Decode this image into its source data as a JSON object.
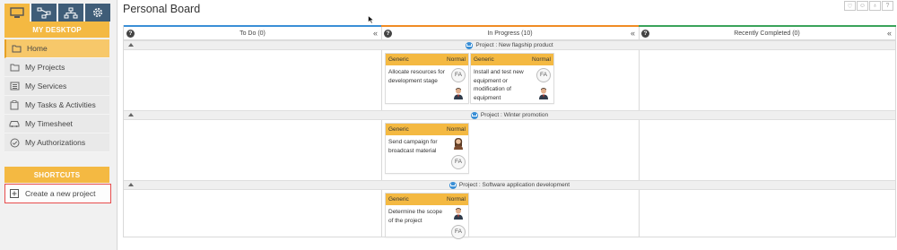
{
  "sidebar": {
    "section_title": "MY DESKTOP",
    "shortcuts_title": "SHORTCUTS",
    "items": [
      {
        "label": "Home",
        "icon": "home-icon",
        "active": true
      },
      {
        "label": "My Projects",
        "icon": "folder-icon"
      },
      {
        "label": "My Services",
        "icon": "list-icon"
      },
      {
        "label": "My Tasks & Activities",
        "icon": "clipboard-icon"
      },
      {
        "label": "My Timesheet",
        "icon": "car-icon"
      },
      {
        "label": "My Authorizations",
        "icon": "check-circle-icon"
      }
    ],
    "shortcut": {
      "label": "Create a new project",
      "icon": "plus-square-icon"
    }
  },
  "header": {
    "title": "Personal Board",
    "icons": [
      "heart-icon",
      "smile-icon",
      "bulb-icon",
      "help-icon"
    ]
  },
  "columns": [
    {
      "label": "To Do (0)",
      "color": "#3a8fd6"
    },
    {
      "label": "In Progress (10)",
      "color": "#f08c24"
    },
    {
      "label": "Recently Completed (0)",
      "color": "#3aa35a"
    }
  ],
  "projects": [
    {
      "label": "Project : New flagship product"
    },
    {
      "label": "Project : Winter promotion"
    },
    {
      "label": "Project : Software application development"
    }
  ],
  "cards": [
    {
      "type": "Generic",
      "priority": "Normal",
      "text": "Allocate resources for development stage",
      "assignee": "FA"
    },
    {
      "type": "Generic",
      "priority": "Normal",
      "text": "Install and test new equipment or modification of equipment",
      "assignee": "FA"
    },
    {
      "type": "Generic",
      "priority": "Normal",
      "text": "Send campaign for broadcast material",
      "assignee": "FA"
    },
    {
      "type": "Generic",
      "priority": "Normal",
      "text": "Determine the scope of the project",
      "assignee": "FA"
    }
  ],
  "colors": {
    "accent": "#f4b942",
    "sidebar_dark": "#3f5d78",
    "highlight_border": "#e74c4c"
  }
}
